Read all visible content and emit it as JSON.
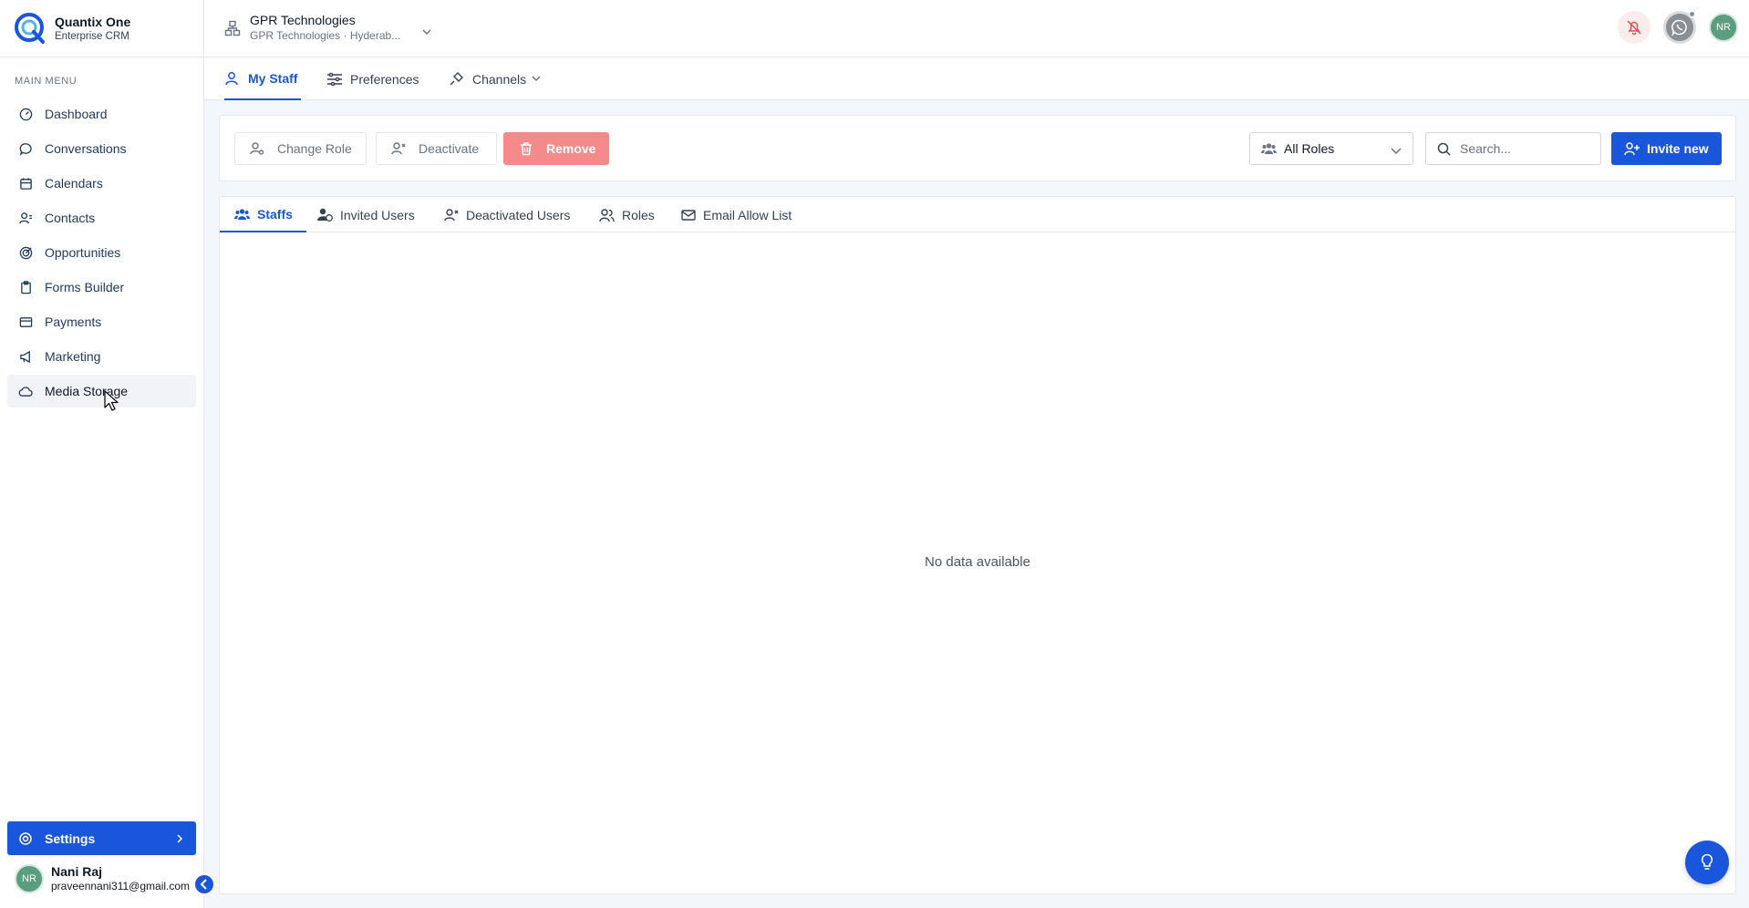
{
  "brand": {
    "name": "Quantix One",
    "subtitle": "Enterprise CRM"
  },
  "sidebar": {
    "menu_title": "MAIN MENU",
    "items": [
      {
        "label": "Dashboard",
        "icon": "dashboard-icon"
      },
      {
        "label": "Conversations",
        "icon": "chat-icon"
      },
      {
        "label": "Calendars",
        "icon": "calendar-icon"
      },
      {
        "label": "Contacts",
        "icon": "contacts-icon"
      },
      {
        "label": "Opportunities",
        "icon": "target-icon"
      },
      {
        "label": "Forms Builder",
        "icon": "clipboard-icon"
      },
      {
        "label": "Payments",
        "icon": "card-icon"
      },
      {
        "label": "Marketing",
        "icon": "megaphone-icon"
      },
      {
        "label": "Media Storage",
        "icon": "cloud-icon"
      }
    ],
    "settings_label": "Settings",
    "user": {
      "initials": "NR",
      "name": "Nani Raj",
      "email": "praveennani311@gmail.com"
    }
  },
  "topbar": {
    "org_name": "GPR Technologies",
    "org_sub": "GPR Technologies · Hyderab...",
    "avatar_initials": "NR"
  },
  "subnav": {
    "tabs": [
      {
        "label": "My Staff",
        "active": true
      },
      {
        "label": "Preferences",
        "active": false
      },
      {
        "label": "Channels",
        "active": false
      }
    ]
  },
  "actions": {
    "change_role": "Change Role",
    "deactivate": "Deactivate",
    "remove": "Remove",
    "roles_filter": "All Roles",
    "search_placeholder": "Search...",
    "invite": "Invite new"
  },
  "content": {
    "tabs": [
      {
        "label": "Staffs",
        "active": true
      },
      {
        "label": "Invited Users",
        "active": false
      },
      {
        "label": "Deactivated Users",
        "active": false
      },
      {
        "label": "Roles",
        "active": false
      },
      {
        "label": "Email Allow List",
        "active": false
      }
    ],
    "empty_message": "No data available"
  },
  "colors": {
    "primary": "#1a56db",
    "remove": "#f58a8a",
    "avatar": "#5b9e7f"
  }
}
